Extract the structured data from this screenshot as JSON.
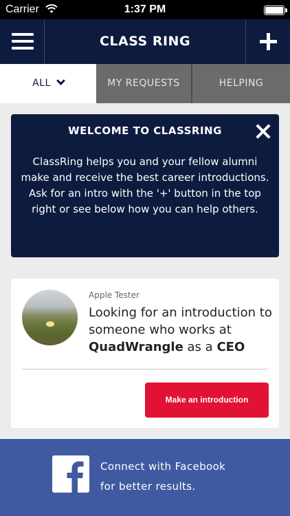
{
  "status_bar": {
    "carrier": "Carrier",
    "time": "1:37 PM"
  },
  "nav": {
    "title": "CLASS RING",
    "menu_icon": "hamburger-menu-icon",
    "add_icon": "plus-icon"
  },
  "tabs": [
    {
      "label": "ALL",
      "active": true
    },
    {
      "label": "MY REQUESTS",
      "active": false
    },
    {
      "label": "HELPING",
      "active": false
    }
  ],
  "welcome": {
    "title": "WELCOME TO CLASSRING",
    "body": "ClassRing helps you and your fellow alumni make and receive the best career introductions. Ask for an intro with the '+' button in the top right or see below how you can help others."
  },
  "request_card": {
    "requester": "Apple Tester",
    "text_prefix": "Looking for an introduction to someone who works at",
    "company": "QuadWrangle",
    "text_middle": "as a",
    "role": "CEO",
    "button_label": "Make an introduction"
  },
  "facebook_banner": {
    "line1": "Connect with Facebook",
    "line2": "for better results."
  },
  "colors": {
    "navy": "#0d1b3f",
    "tab_gray": "#6b6b6b",
    "accent_red": "#e11235",
    "facebook_blue": "#3f5aa0"
  }
}
